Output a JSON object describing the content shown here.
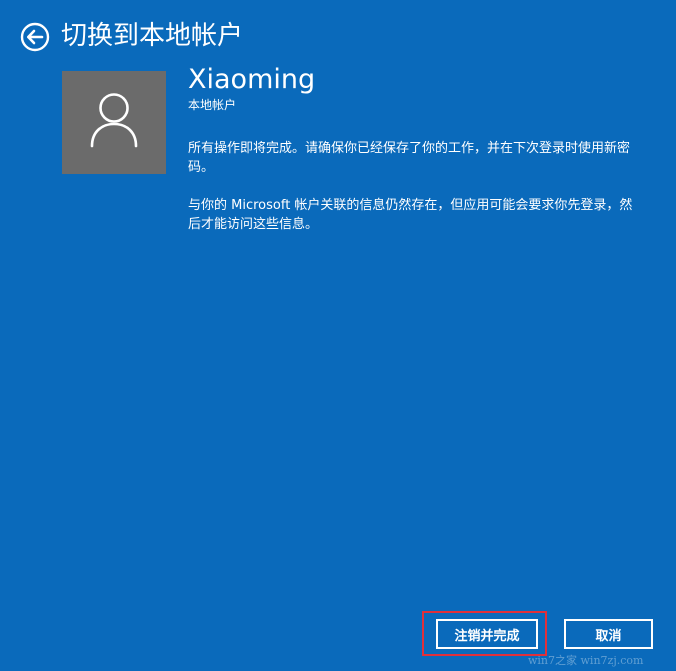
{
  "header": {
    "title": "切换到本地帐户",
    "back_icon": "back-arrow-icon"
  },
  "account": {
    "avatar_icon": "user-icon",
    "name": "Xiaoming",
    "type": "本地帐户"
  },
  "messages": [
    "所有操作即将完成。请确保你已经保存了你的工作，并在下次登录时使用新密码。",
    "与你的 Microsoft 帐户关联的信息仍然存在，但应用可能会要求你先登录，然后才能访问这些信息。"
  ],
  "buttons": {
    "signout_label": "注销并完成",
    "cancel_label": "取消"
  },
  "colors": {
    "background": "#0a6abb",
    "avatar_background": "#6b6b6b",
    "highlight": "#e0303a",
    "text": "#ffffff"
  },
  "watermark": "win7之家 win7zj.com"
}
